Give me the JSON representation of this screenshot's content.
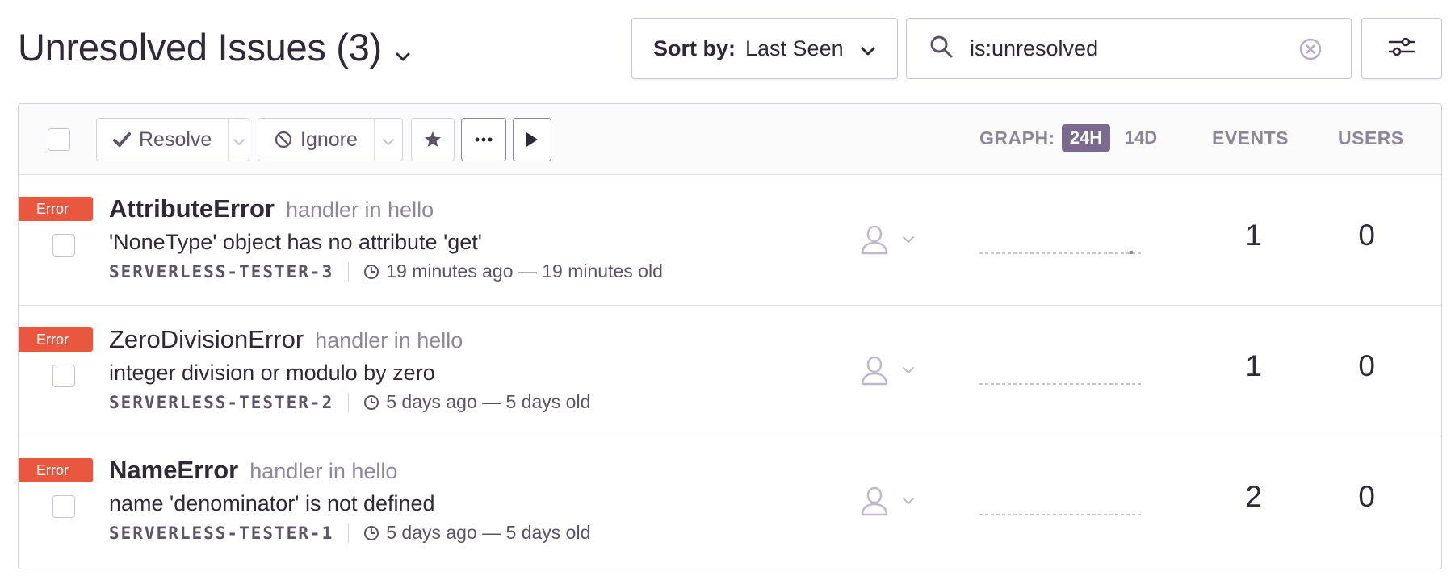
{
  "header": {
    "title": "Unresolved Issues (3)",
    "sort": {
      "label": "Sort by:",
      "value": "Last Seen"
    },
    "search": {
      "value": "is:unresolved",
      "placeholder": ""
    }
  },
  "toolbar": {
    "resolve_label": "Resolve",
    "ignore_label": "Ignore",
    "graph_label": "GRAPH:",
    "graph_options": [
      "24H",
      "14D"
    ],
    "graph_selected": "24H",
    "events_header": "EVENTS",
    "users_header": "USERS"
  },
  "issues": [
    {
      "level": "Error",
      "title": "AttributeError",
      "title_bold": true,
      "culprit": "handler in hello",
      "message": "'NoneType' object has no attribute 'get'",
      "short_id": "SERVERLESS-TESTER-3",
      "time": "19 minutes ago — 19 minutes old",
      "events": "1",
      "users": "0"
    },
    {
      "level": "Error",
      "title": "ZeroDivisionError",
      "title_bold": false,
      "culprit": "handler in hello",
      "message": "integer division or modulo by zero",
      "short_id": "SERVERLESS-TESTER-2",
      "time": "5 days ago — 5 days old",
      "events": "1",
      "users": "0"
    },
    {
      "level": "Error",
      "title": "NameError",
      "title_bold": true,
      "culprit": "handler in hello",
      "message": "name 'denominator' is not defined",
      "short_id": "SERVERLESS-TESTER-1",
      "time": "5 days ago — 5 days old",
      "events": "2",
      "users": "0"
    }
  ],
  "colors": {
    "error_badge": "#e9573f",
    "graph_active": "#7c6a8e",
    "text_primary": "#2f2936",
    "text_muted": "#8e8799"
  },
  "icons": [
    "chevron-down-icon",
    "search-icon",
    "clear-icon",
    "filter-sliders-icon",
    "checkmark-icon",
    "ignore-icon",
    "star-icon",
    "more-icon",
    "play-icon",
    "user-icon",
    "clock-icon"
  ]
}
